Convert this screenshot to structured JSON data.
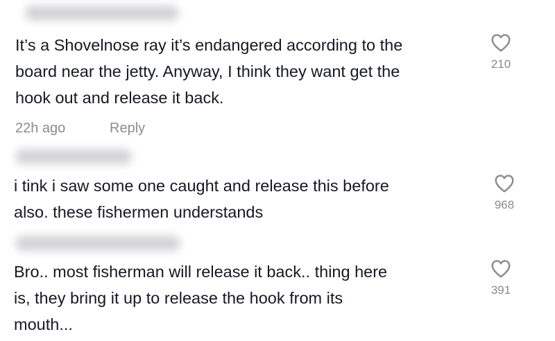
{
  "comments": [
    {
      "lines": [
        "It’s a Shovelnose ray it’s endangered according to the",
        "board near the jetty. Anyway, I think they want get the",
        "hook out and release it back."
      ],
      "time": "22h ago",
      "reply_label": "Reply",
      "likes": "210",
      "like_icon": "heart-outline-icon"
    },
    {
      "lines": [
        "i tink i saw some one caught and release this before",
        "also. these fishermen understands"
      ],
      "likes": "968",
      "like_icon": "heart-outline-icon"
    },
    {
      "lines": [
        "Bro.. most fisherman will release it back.. thing here",
        "is, they bring it up to release the hook from its",
        "mouth..."
      ],
      "likes": "391",
      "like_icon": "heart-outline-icon"
    }
  ],
  "colors": {
    "text": "#161823",
    "meta": "#8a8b91",
    "icon": "#8a8b91"
  }
}
